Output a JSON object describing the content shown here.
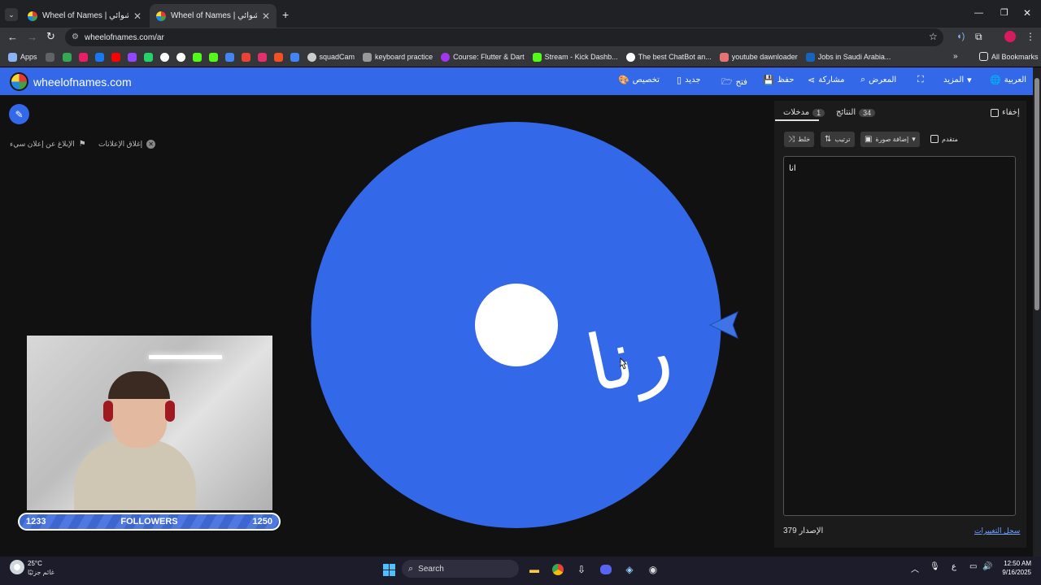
{
  "browser": {
    "tabs": [
      {
        "title": "Wheel of Names | اسم العشوائي"
      },
      {
        "title": "Wheel of Names | اسم العشوائي"
      }
    ],
    "url": "wheelofnames.com/ar",
    "bookmarks": [
      "Apps",
      "squadCam",
      "keyboard practice",
      "Course: Flutter & Dart",
      "Stream - Kick Dashb...",
      "The best ChatBot an...",
      "youtube dawnloader",
      "Jobs in Saudi Arabia..."
    ],
    "all_bookmarks": "All Bookmarks"
  },
  "site": {
    "brand": "wheelofnames.com",
    "nav": {
      "customize": "تخصيص",
      "new": "جديد",
      "open": "فتح",
      "save": "حفظ",
      "share": "مشاركة",
      "gallery": "المعرض",
      "more": "المزيد",
      "language": "العربية"
    }
  },
  "ads": {
    "close_ads": "إغلاق الإعلانات",
    "report_ad": "الإبلاغ عن إعلان سيء"
  },
  "wheel": {
    "segment_label": "رنا",
    "color": "#3369e8"
  },
  "followers": {
    "current": "1233",
    "label": "FOLLOWERS",
    "goal": "1250"
  },
  "panel": {
    "hide_label": "إخفاء",
    "results_label": "النتائج",
    "results_count": "34",
    "entries_label": "مدخلات",
    "entries_count": "1",
    "shuffle": "خلط",
    "sort": "ترتيب",
    "add_image": "إضافة صورة",
    "advanced": "متقدم",
    "entries_text": "انا",
    "changelog": "سجل التغييرات",
    "version": "الإصدار 379"
  },
  "taskbar": {
    "temperature": "25°C",
    "weather_text": "غائم جزئيًا",
    "search": "Search",
    "lang": "ع",
    "time": "12:50 AM",
    "date": "9/16/2025"
  }
}
